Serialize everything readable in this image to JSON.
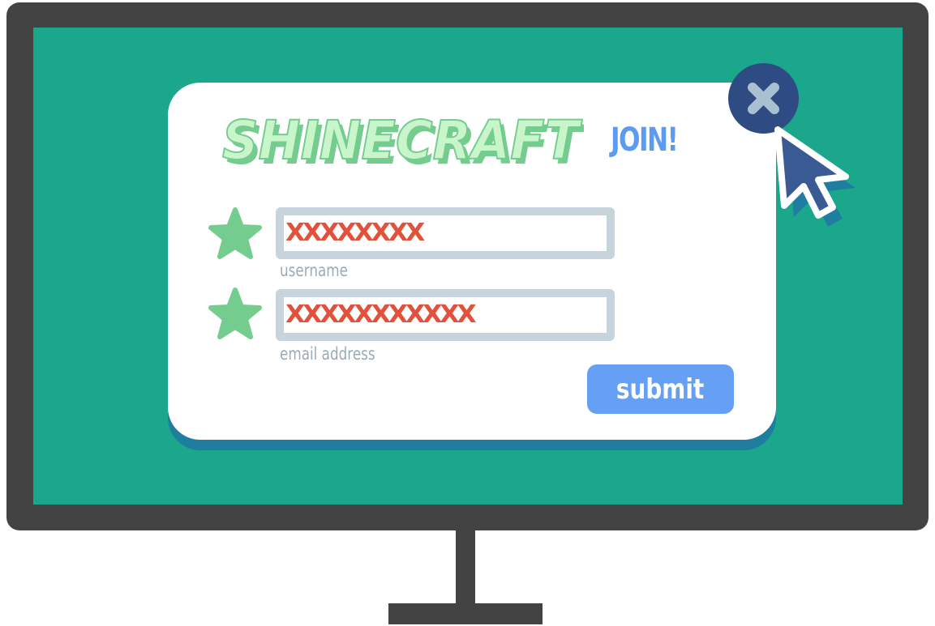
{
  "colors": {
    "screen": "#1aa78c",
    "monitor": "#434343",
    "dialog": "#ffffff",
    "dialog_shadow": "#1f7ea0",
    "logo_face": "#c8f5c9",
    "logo_side": "#74cc8e",
    "accent_blue": "#5b9bf0",
    "button": "#66a0f5",
    "field_border": "#c7d4dc",
    "masked_text": "#e2513b",
    "star": "#74cc8e",
    "close_button": "#2f4b83",
    "cursor": "#3a5a94"
  },
  "dialog": {
    "logo_text": "SHINECRAFT",
    "title": "JOIN!",
    "fields": [
      {
        "value": "XXXXXXXX",
        "label": "username",
        "icon": "star-icon"
      },
      {
        "value": "XXXXXXXXXXX",
        "label": "email address",
        "icon": "star-icon"
      }
    ],
    "submit_label": "submit",
    "close_icon": "close-icon"
  },
  "cursor_icon": "pointer-cursor-icon"
}
